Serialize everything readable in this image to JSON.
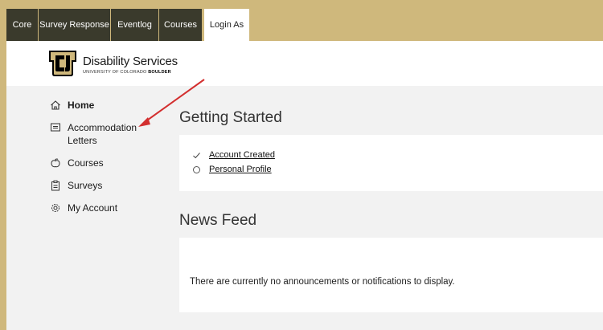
{
  "tabs": [
    {
      "label": "Core"
    },
    {
      "label": "Survey Response"
    },
    {
      "label": "Eventlog"
    },
    {
      "label": "Courses"
    },
    {
      "label": "Login As"
    }
  ],
  "header": {
    "logo_title": "Disability Services",
    "logo_sub_prefix": "UNIVERSITY OF COLORADO ",
    "logo_sub_bold": "BOULDER",
    "logo_monogram": "CU"
  },
  "nav": {
    "items": [
      {
        "label": "Home",
        "icon": "home-icon"
      },
      {
        "label": "Accommodation Letters",
        "icon": "letter-icon"
      },
      {
        "label": "Courses",
        "icon": "apple-icon"
      },
      {
        "label": "Surveys",
        "icon": "clipboard-icon"
      },
      {
        "label": "My Account",
        "icon": "gear-icon"
      }
    ]
  },
  "getting_started": {
    "title": "Getting Started",
    "steps": [
      {
        "label": "Account Created",
        "status": "done"
      },
      {
        "label": "Personal Profile",
        "status": "todo"
      }
    ]
  },
  "news": {
    "title": "News Feed",
    "empty_message": "There are currently no announcements or notifications to display."
  },
  "colors": {
    "gold": "#cfb87c",
    "tab_dark": "#3a3a2c",
    "annotation_arrow": "#d32f2f"
  }
}
